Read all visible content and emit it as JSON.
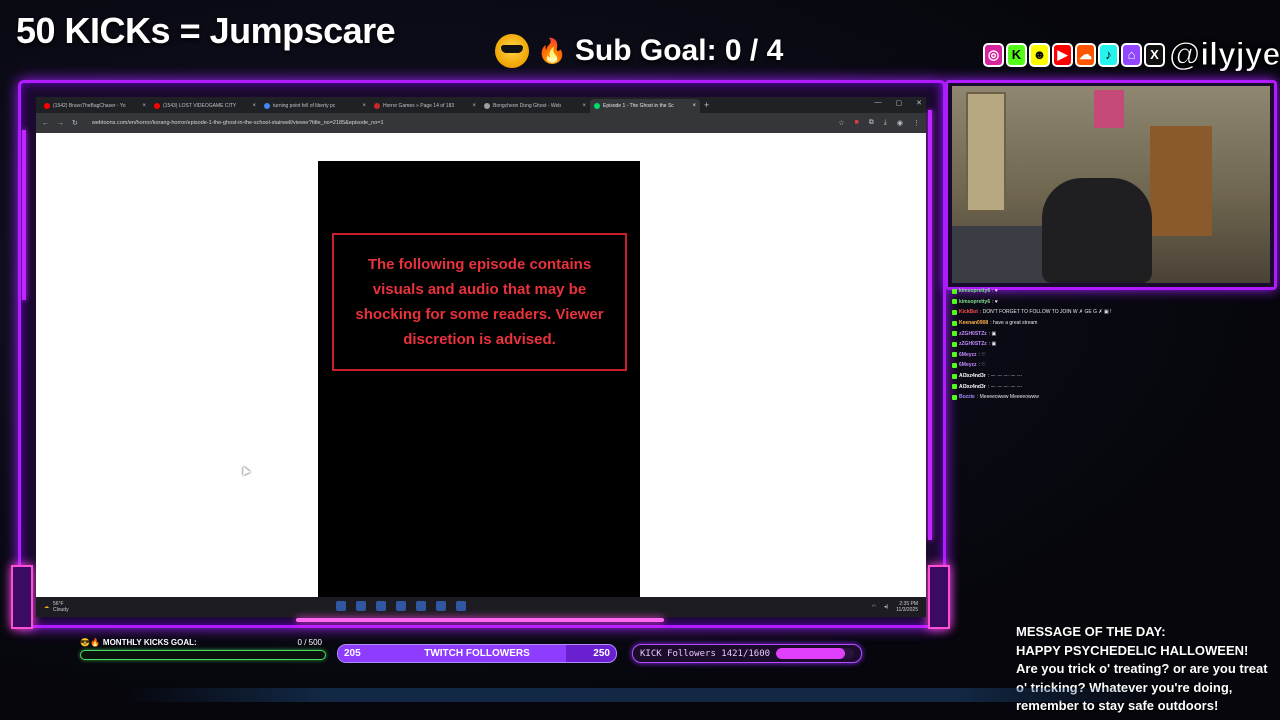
{
  "overlay": {
    "kick_title": "50 KICKs = Jumpscare",
    "sub_goal": "Sub Goal:  0 / 4",
    "handle": "@ilyjye",
    "socials": [
      {
        "icon": "instagram-icon",
        "glyph": "◎",
        "color": "#d6249f"
      },
      {
        "icon": "kick-icon",
        "glyph": "K",
        "color": "#53fc18"
      },
      {
        "icon": "snapchat-icon",
        "glyph": "☻",
        "color": "#fffc00"
      },
      {
        "icon": "youtube-icon",
        "glyph": "▶",
        "color": "#ff0000"
      },
      {
        "icon": "soundcloud-icon",
        "glyph": "☁",
        "color": "#ff5500"
      },
      {
        "icon": "tiktok-icon",
        "glyph": "♪",
        "color": "#25f4ee"
      },
      {
        "icon": "twitch-icon",
        "glyph": "⌂",
        "color": "#9146ff"
      },
      {
        "icon": "x-icon",
        "glyph": "X",
        "color": "#ffffff"
      }
    ]
  },
  "browser": {
    "tabs": [
      {
        "label": "(1542) BravoTheBagChaser - Yo",
        "color": "#ff0000"
      },
      {
        "label": "(1543) LOST VIDEOGAME CITY",
        "color": "#ff0000"
      },
      {
        "label": "turning point fell of liberty pc",
        "color": "#4285f4"
      },
      {
        "label": "Horror Games » Page 14 of 183",
        "color": "#c62828"
      },
      {
        "label": "Bongcheon Dong Ghost - Web",
        "color": "#9e9e9e"
      },
      {
        "label": "Episode 1 - The Ghost in the Sc",
        "color": "#00dc64",
        "active": true
      }
    ],
    "url": "webtoons.com/en/horror/korang-horror/episode-1-the-ghost-in-the-school-stairwell/viewer?title_no=2185&episode_no=1",
    "warning": "The following episode contains visuals and audio that may be shocking for some readers. Viewer discretion is advised.",
    "taskbar": {
      "temp": "56°F",
      "weather": "Cloudy",
      "time": "2:35 PM",
      "date": "11/3/2025"
    }
  },
  "chat": [
    {
      "user": "kimsopretty6",
      "color": "#7ee08a",
      "msg": ": ♥"
    },
    {
      "user": "kimsopretty6",
      "color": "#7ee08a",
      "msg": ": ♥"
    },
    {
      "user": "KickBot",
      "color": "#ff4d4d",
      "msg": ": DON'T FORGET TO FOLLOW TO JOIN W ✗ GE G ✗ ▣ !"
    },
    {
      "user": "Keenan0908",
      "color": "#ffb347",
      "msg": ": have a great stream"
    },
    {
      "user": "zZGH0STZz",
      "color": "#c48bff",
      "msg": ": ▣"
    },
    {
      "user": "zZGH0STZz",
      "color": "#c48bff",
      "msg": ": ▣"
    },
    {
      "user": "6Meyzz",
      "color": "#c48bff",
      "msg": ": ♡"
    },
    {
      "user": "6Meyzz",
      "color": "#c48bff",
      "msg": ": ♡"
    },
    {
      "user": "Al3xz4nd3r",
      "color": "#ffffff",
      "msg": ": ·ᵕ· ·ᵕ· ·ᵕ· ·ᵕ· ·ᵕ·"
    },
    {
      "user": "Al3xz4nd3r",
      "color": "#ffffff",
      "msg": ": ·ᵕ· ·ᵕ· ·ᵕ· ·ᵕ· ·ᵕ·"
    },
    {
      "user": "Bozzie",
      "color": "#a38bff",
      "msg": ": Meeeeowww Meeeeowww"
    }
  ],
  "motd": {
    "title": "MESSAGE OF THE DAY:",
    "line1": "HAPPY PSYCHEDELIC HALLOWEEN!",
    "body": "Are you trick o' treating? or are you treat o' tricking? Whatever you're doing, remember to stay safe outdoors!"
  },
  "goals": {
    "monthly_kicks_label": "MONTHLY KICKS GOAL:",
    "monthly_kicks_count": "0 / 500",
    "monthly_kicks_fraction": 0.0,
    "twitch_label": "TWITCH FOLLOWERS",
    "twitch_current": "205",
    "twitch_target": "250",
    "twitch_fraction": 0.82,
    "kick_followers_label": "KICK Followers 1421/1600",
    "kick_followers_fraction": 0.888
  },
  "colors": {
    "neon_purple": "#b11bff",
    "neon_pink": "#ff4fd8",
    "warning_red": "#e8323c",
    "kick_green": "#53fc18"
  }
}
